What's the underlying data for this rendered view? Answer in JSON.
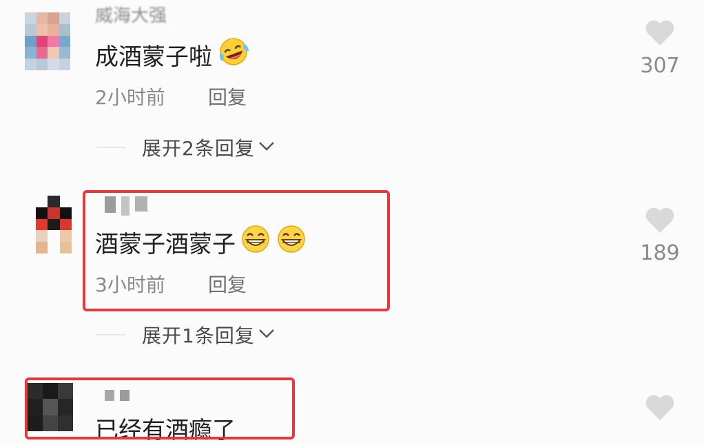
{
  "comments": [
    {
      "username": "威海大强",
      "text": "成酒蒙子啦",
      "emoji": "laughing-tears",
      "time": "2小时前",
      "reply_label": "回复",
      "expand_label": "展开2条回复",
      "likes": "307"
    },
    {
      "username": "",
      "text": "酒蒙子酒蒙子",
      "emoji": "grin-grin",
      "time": "3小时前",
      "reply_label": "回复",
      "expand_label": "展开1条回复",
      "likes": "189"
    },
    {
      "username": "",
      "text": "已经有酒瘾了",
      "emoji": "",
      "time": "",
      "reply_label": "",
      "expand_label": "",
      "likes": ""
    }
  ],
  "colors": {
    "highlight": "#e23a3a",
    "like_icon": "#d9d9d9",
    "muted_text": "#8a8a8a"
  }
}
